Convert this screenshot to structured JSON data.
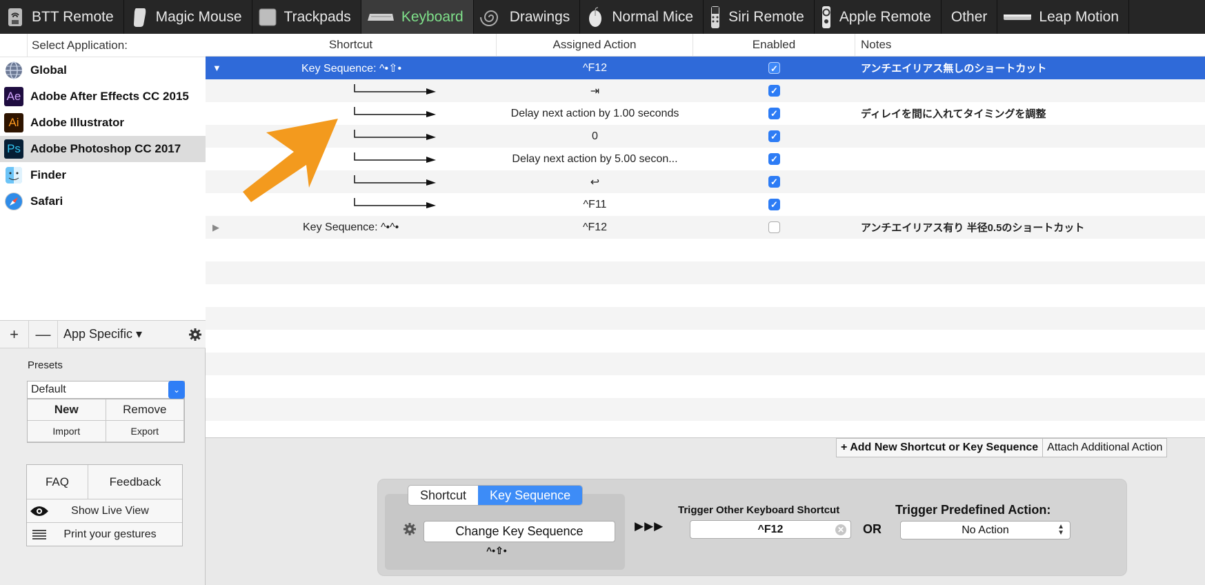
{
  "toolbar": {
    "tabs": [
      {
        "label": "BTT Remote",
        "icon": "btt-remote-icon"
      },
      {
        "label": "Magic Mouse",
        "icon": "magic-mouse-icon"
      },
      {
        "label": "Trackpads",
        "icon": "trackpad-icon"
      },
      {
        "label": "Keyboard",
        "icon": "keyboard-icon",
        "active": true
      },
      {
        "label": "Drawings",
        "icon": "drawing-icon"
      },
      {
        "label": "Normal Mice",
        "icon": "mouse-icon"
      },
      {
        "label": "Siri Remote",
        "icon": "siri-remote-icon"
      },
      {
        "label": "Apple Remote",
        "icon": "apple-remote-icon"
      },
      {
        "label": "Other"
      },
      {
        "label": "Leap Motion",
        "icon": "leap-motion-icon"
      }
    ],
    "active_color": "#7fe08a"
  },
  "sidebar": {
    "header": "Select Application:",
    "apps": [
      {
        "name": "Global",
        "icon": "globe-icon"
      },
      {
        "name": "Adobe After Effects CC 2015",
        "icon": "after-effects-icon",
        "badge": "Ae"
      },
      {
        "name": "Adobe Illustrator",
        "icon": "illustrator-icon",
        "badge": "Ai"
      },
      {
        "name": "Adobe Photoshop CC 2017",
        "icon": "photoshop-icon",
        "badge": "Ps",
        "selected": true
      },
      {
        "name": "Finder",
        "icon": "finder-icon"
      },
      {
        "name": "Safari",
        "icon": "safari-icon"
      }
    ],
    "add_label": "+",
    "remove_label": "—",
    "scope_label": "App Specific ▾",
    "presets_label": "Presets",
    "preset_value": "Default",
    "preset_buttons": {
      "new": "New",
      "remove": "Remove",
      "import": "Import",
      "export": "Export"
    },
    "faq": "FAQ",
    "feedback": "Feedback",
    "live_view": "Show Live View",
    "print_gestures": "Print your gestures"
  },
  "table": {
    "headers": {
      "shortcut": "Shortcut",
      "action": "Assigned Action",
      "enabled": "Enabled",
      "notes": "Notes"
    },
    "rows": [
      {
        "shortcut": "Key Sequence: ^•⇧•",
        "action": "^F12",
        "enabled": true,
        "notes": "アンチエイリアス無しのショートカット",
        "expanded": true,
        "selected": true
      },
      {
        "child": true,
        "action": "⇥",
        "enabled": true,
        "notes": ""
      },
      {
        "child": true,
        "action": "Delay next action by 1.00 seconds",
        "enabled": true,
        "notes": "ディレイを間に入れてタイミングを調整"
      },
      {
        "child": true,
        "action": "0",
        "enabled": true,
        "notes": ""
      },
      {
        "child": true,
        "action": "Delay next action by 5.00 secon...",
        "enabled": true,
        "notes": ""
      },
      {
        "child": true,
        "action": "↩",
        "enabled": true,
        "notes": ""
      },
      {
        "child": true,
        "action": "^F11",
        "enabled": true,
        "notes": ""
      },
      {
        "shortcut": "Key Sequence: ^•^•",
        "action": "^F12",
        "enabled": false,
        "notes": "アンチエイリアス有り 半径0.5のショートカット",
        "expanded": false
      }
    ],
    "selected_color": "#2f6ad9"
  },
  "actions": {
    "add": "+ Add New Shortcut or Key Sequence",
    "attach": "Attach Additional Action"
  },
  "config": {
    "seg_shortcut": "Shortcut",
    "seg_sequence": "Key Sequence",
    "change_button": "Change Key Sequence",
    "sequence_caption": "^•⇧•",
    "triple_arrow": "▶▶▶",
    "trigger_label": "Trigger Other Keyboard Shortcut",
    "trigger_value": "^F12",
    "or_label": "OR",
    "predefined_label": "Trigger Predefined Action:",
    "predefined_value": "No Action",
    "accent": "#3d8cf7"
  },
  "annotation": {
    "color": "#f39a1e",
    "icon": "orange-arrow-icon"
  }
}
